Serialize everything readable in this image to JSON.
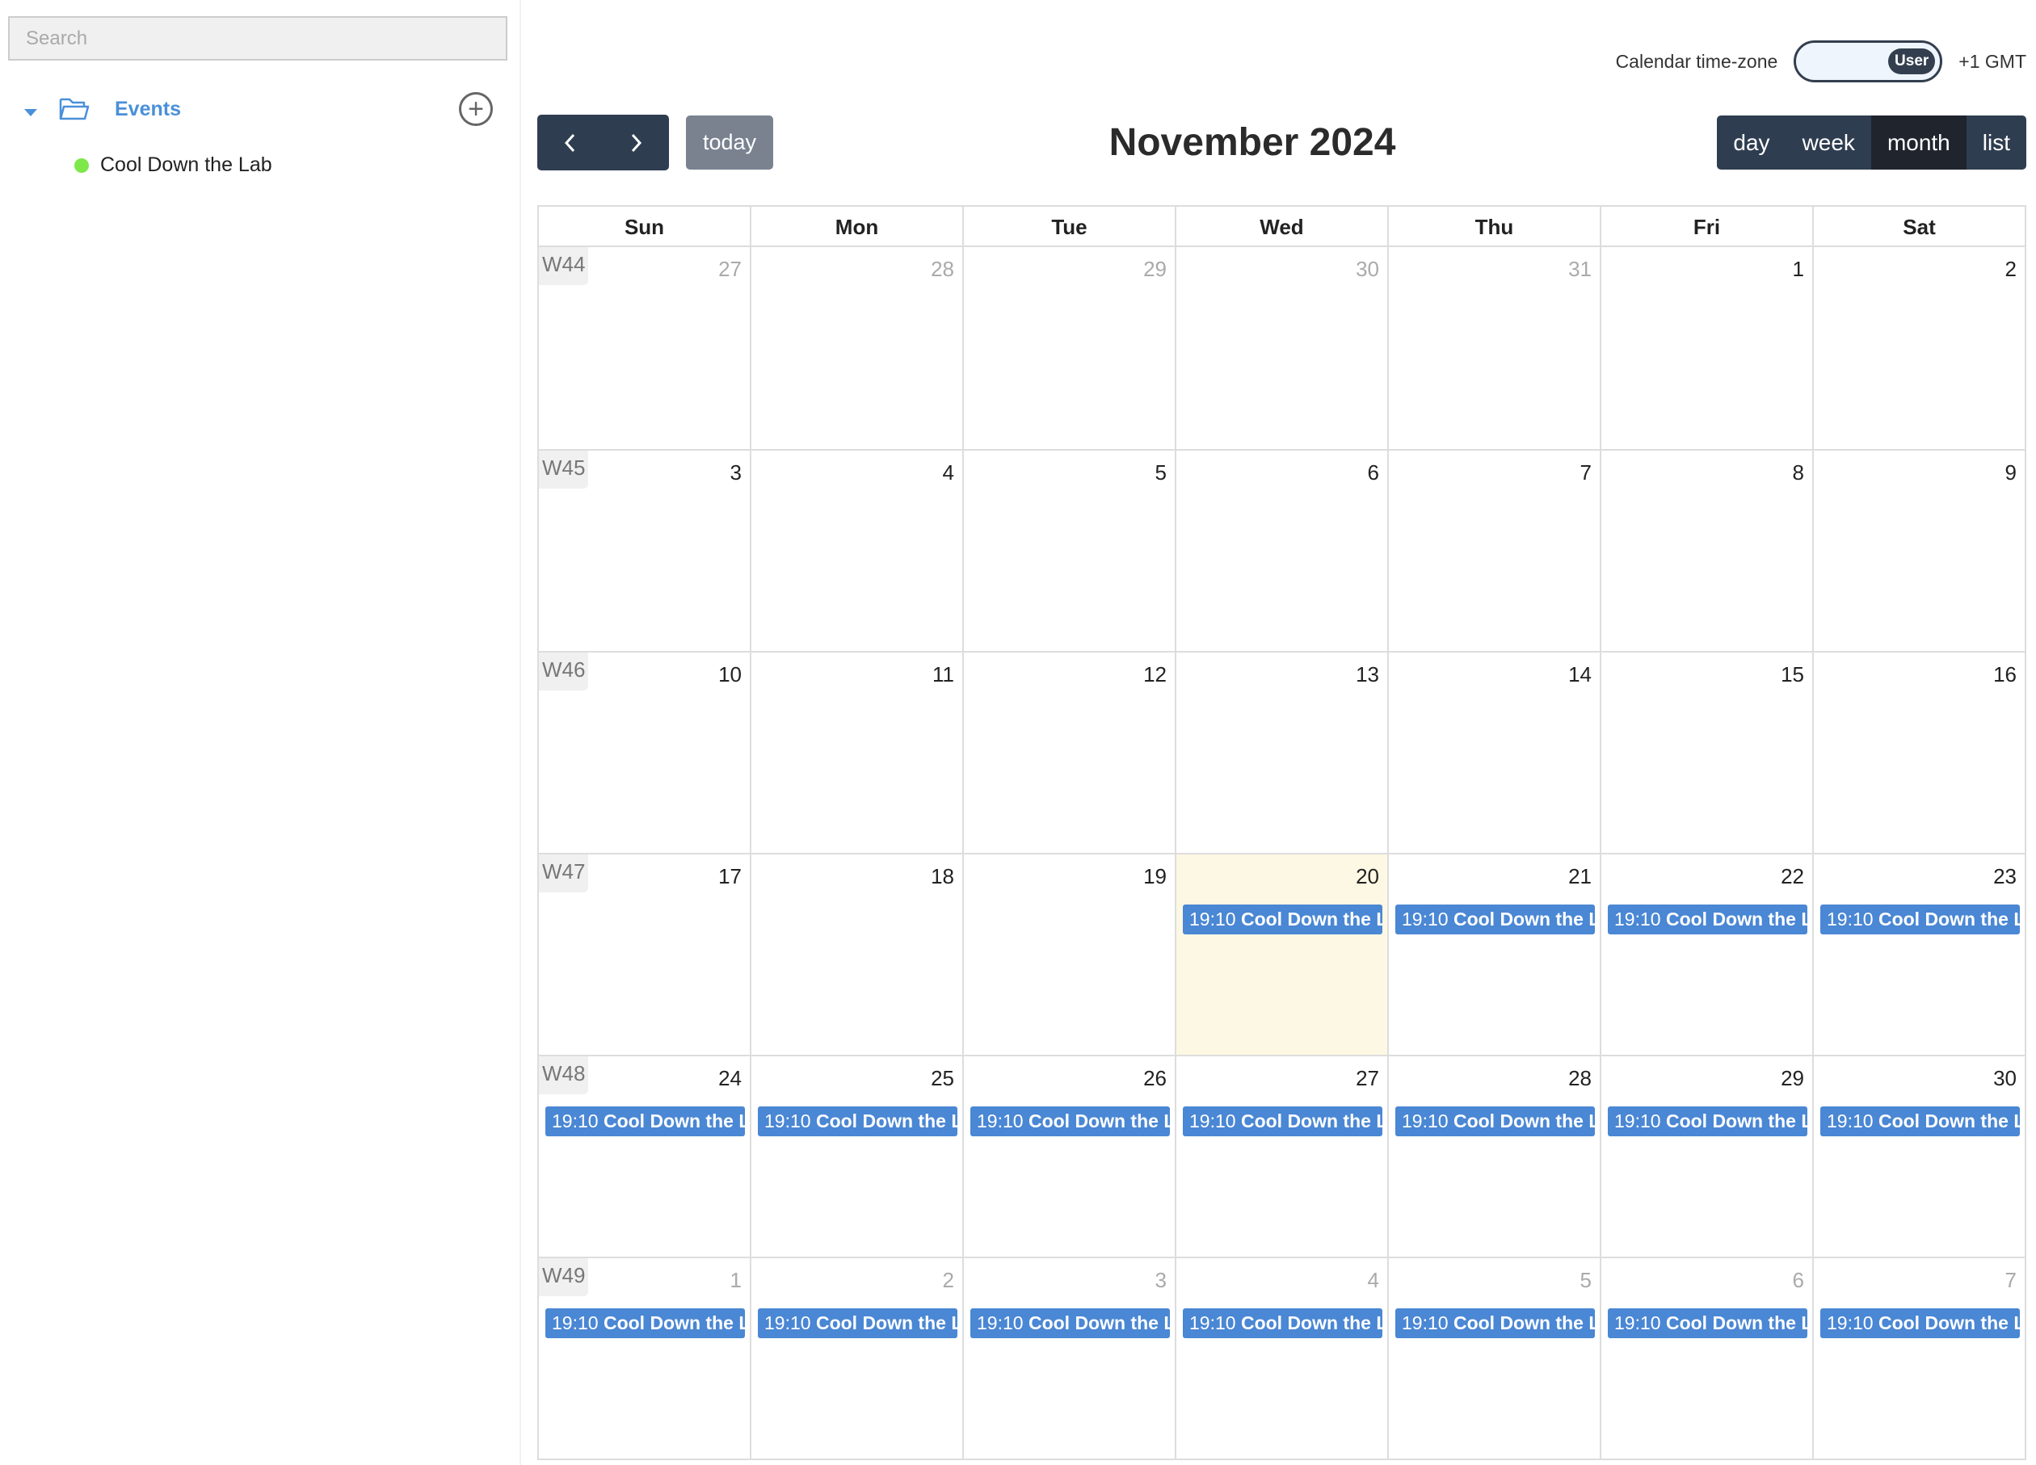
{
  "sidebar": {
    "search_placeholder": "Search",
    "folder": {
      "label": "Events",
      "icon": "folder-open-icon",
      "expanded": true
    },
    "add_icon": "plus-circle-icon",
    "calendars": [
      {
        "label": "Cool Down the Lab",
        "color": "#7ee84a"
      }
    ]
  },
  "timezone": {
    "label": "Calendar time-zone",
    "toggle_label": "User",
    "value": "+1 GMT"
  },
  "toolbar": {
    "prev_icon": "chevron-left-icon",
    "next_icon": "chevron-right-icon",
    "today_label": "today",
    "title": "November 2024",
    "views": [
      {
        "label": "day",
        "active": false
      },
      {
        "label": "week",
        "active": false
      },
      {
        "label": "month",
        "active": true
      },
      {
        "label": "list",
        "active": false
      }
    ]
  },
  "calendar": {
    "weekdays": [
      "Sun",
      "Mon",
      "Tue",
      "Wed",
      "Thu",
      "Fri",
      "Sat"
    ],
    "event_color": "#4a87d4",
    "today_highlight": "#fdf8e3",
    "weeks": [
      {
        "label": "W44",
        "days": [
          {
            "n": "27",
            "other": true
          },
          {
            "n": "28",
            "other": true
          },
          {
            "n": "29",
            "other": true
          },
          {
            "n": "30",
            "other": true
          },
          {
            "n": "31",
            "other": true
          },
          {
            "n": "1"
          },
          {
            "n": "2"
          }
        ]
      },
      {
        "label": "W45",
        "days": [
          {
            "n": "3"
          },
          {
            "n": "4"
          },
          {
            "n": "5"
          },
          {
            "n": "6"
          },
          {
            "n": "7"
          },
          {
            "n": "8"
          },
          {
            "n": "9"
          }
        ]
      },
      {
        "label": "W46",
        "days": [
          {
            "n": "10"
          },
          {
            "n": "11"
          },
          {
            "n": "12"
          },
          {
            "n": "13"
          },
          {
            "n": "14"
          },
          {
            "n": "15"
          },
          {
            "n": "16"
          }
        ]
      },
      {
        "label": "W47",
        "days": [
          {
            "n": "17"
          },
          {
            "n": "18"
          },
          {
            "n": "19"
          },
          {
            "n": "20",
            "today": true,
            "event": {
              "time": "19:10",
              "title": "Cool Down the La"
            }
          },
          {
            "n": "21",
            "event": {
              "time": "19:10",
              "title": "Cool Down the La"
            }
          },
          {
            "n": "22",
            "event": {
              "time": "19:10",
              "title": "Cool Down the La"
            }
          },
          {
            "n": "23",
            "event": {
              "time": "19:10",
              "title": "Cool Down the La"
            }
          }
        ]
      },
      {
        "label": "W48",
        "days": [
          {
            "n": "24",
            "event": {
              "time": "19:10",
              "title": "Cool Down the La"
            }
          },
          {
            "n": "25",
            "event": {
              "time": "19:10",
              "title": "Cool Down the La"
            }
          },
          {
            "n": "26",
            "event": {
              "time": "19:10",
              "title": "Cool Down the La"
            }
          },
          {
            "n": "27",
            "event": {
              "time": "19:10",
              "title": "Cool Down the La"
            }
          },
          {
            "n": "28",
            "event": {
              "time": "19:10",
              "title": "Cool Down the La"
            }
          },
          {
            "n": "29",
            "event": {
              "time": "19:10",
              "title": "Cool Down the La"
            }
          },
          {
            "n": "30",
            "event": {
              "time": "19:10",
              "title": "Cool Down the La"
            }
          }
        ]
      },
      {
        "label": "W49",
        "days": [
          {
            "n": "1",
            "other": true,
            "event": {
              "time": "19:10",
              "title": "Cool Down the La"
            }
          },
          {
            "n": "2",
            "other": true,
            "event": {
              "time": "19:10",
              "title": "Cool Down the La"
            }
          },
          {
            "n": "3",
            "other": true,
            "event": {
              "time": "19:10",
              "title": "Cool Down the La"
            }
          },
          {
            "n": "4",
            "other": true,
            "event": {
              "time": "19:10",
              "title": "Cool Down the La"
            }
          },
          {
            "n": "5",
            "other": true,
            "event": {
              "time": "19:10",
              "title": "Cool Down the La"
            }
          },
          {
            "n": "6",
            "other": true,
            "event": {
              "time": "19:10",
              "title": "Cool Down the La"
            }
          },
          {
            "n": "7",
            "other": true,
            "event": {
              "time": "19:10",
              "title": "Cool Down the La"
            }
          }
        ]
      }
    ]
  }
}
